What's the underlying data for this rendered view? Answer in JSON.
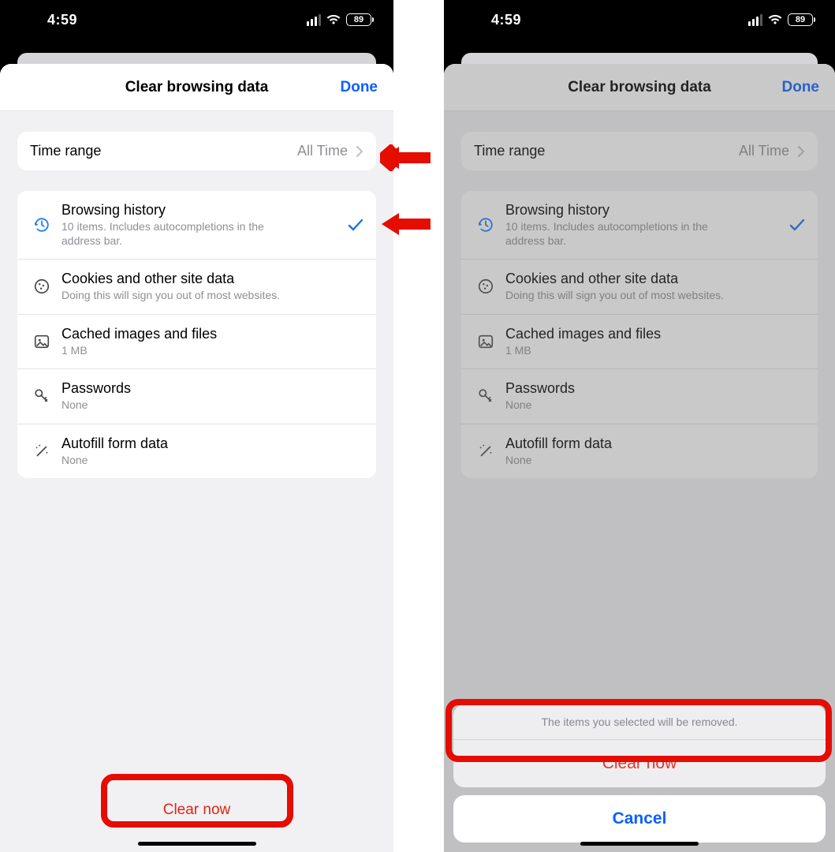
{
  "status": {
    "time": "4:59",
    "battery": "89"
  },
  "nav": {
    "title": "Clear browsing data",
    "done": "Done"
  },
  "timeRange": {
    "label": "Time range",
    "value": "All Time"
  },
  "items": {
    "history": {
      "title": "Browsing history",
      "sub": "10 items. Includes autocompletions in the address bar."
    },
    "cookies": {
      "title": "Cookies and other site data",
      "sub": "Doing this will sign you out of most websites."
    },
    "cache": {
      "title": "Cached images and files",
      "sub": "1 MB"
    },
    "passwords": {
      "title": "Passwords",
      "sub": "None"
    },
    "autofill": {
      "title": "Autofill form data",
      "sub": "None"
    }
  },
  "clearNow": "Clear now",
  "actionSheet": {
    "message": "The items you selected will be removed.",
    "clear": "Clear now",
    "cancel": "Cancel"
  }
}
